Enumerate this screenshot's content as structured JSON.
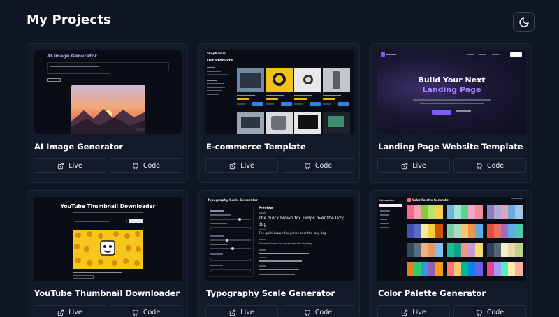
{
  "header": {
    "title": "My Projects",
    "theme_toggle_icon": "moon-icon"
  },
  "projects": [
    {
      "title": "AI Image Generator",
      "live_label": "Live",
      "code_label": "Code",
      "thumb": {
        "heading": "AI Image Generator"
      }
    },
    {
      "title": "E-commerce Template",
      "live_label": "Live",
      "code_label": "Code",
      "thumb": {
        "brand": "ShopMaster",
        "heading": "Our Products"
      }
    },
    {
      "title": "Landing Page Website Template",
      "live_label": "Live",
      "code_label": "Code",
      "thumb": {
        "line1": "Build Your Next",
        "line2": "Landing Page"
      }
    },
    {
      "title": "YouTube Thumbnail Downloader",
      "live_label": "Live",
      "code_label": "Code",
      "thumb": {
        "heading": "YouTube Thumbnail Downloader"
      }
    },
    {
      "title": "Typography Scale Generator",
      "live_label": "Live",
      "code_label": "Code",
      "thumb": {
        "heading": "Typography Scale Generator",
        "preview_label": "Preview",
        "sample_large": "The quick brown fox jumps over the lazy dog",
        "sample_medium": "The quick brown fox jumps over the lazy dog",
        "sample_small": "The quick brown fox jumps over the lazy dog"
      }
    },
    {
      "title": "Color Palette Generator",
      "live_label": "Live",
      "code_label": "Code",
      "thumb": {
        "heading": "Color Palette Generator",
        "sidebar_heading": "Categories"
      }
    }
  ],
  "icons": {
    "live": "external-link-icon",
    "code": "github-icon"
  },
  "colors": {
    "background": "#0f1522",
    "card": "#121a29",
    "card_border": "#1f2737",
    "landing_accent": "#7c5cff",
    "shop_button": "#2f86d6"
  }
}
